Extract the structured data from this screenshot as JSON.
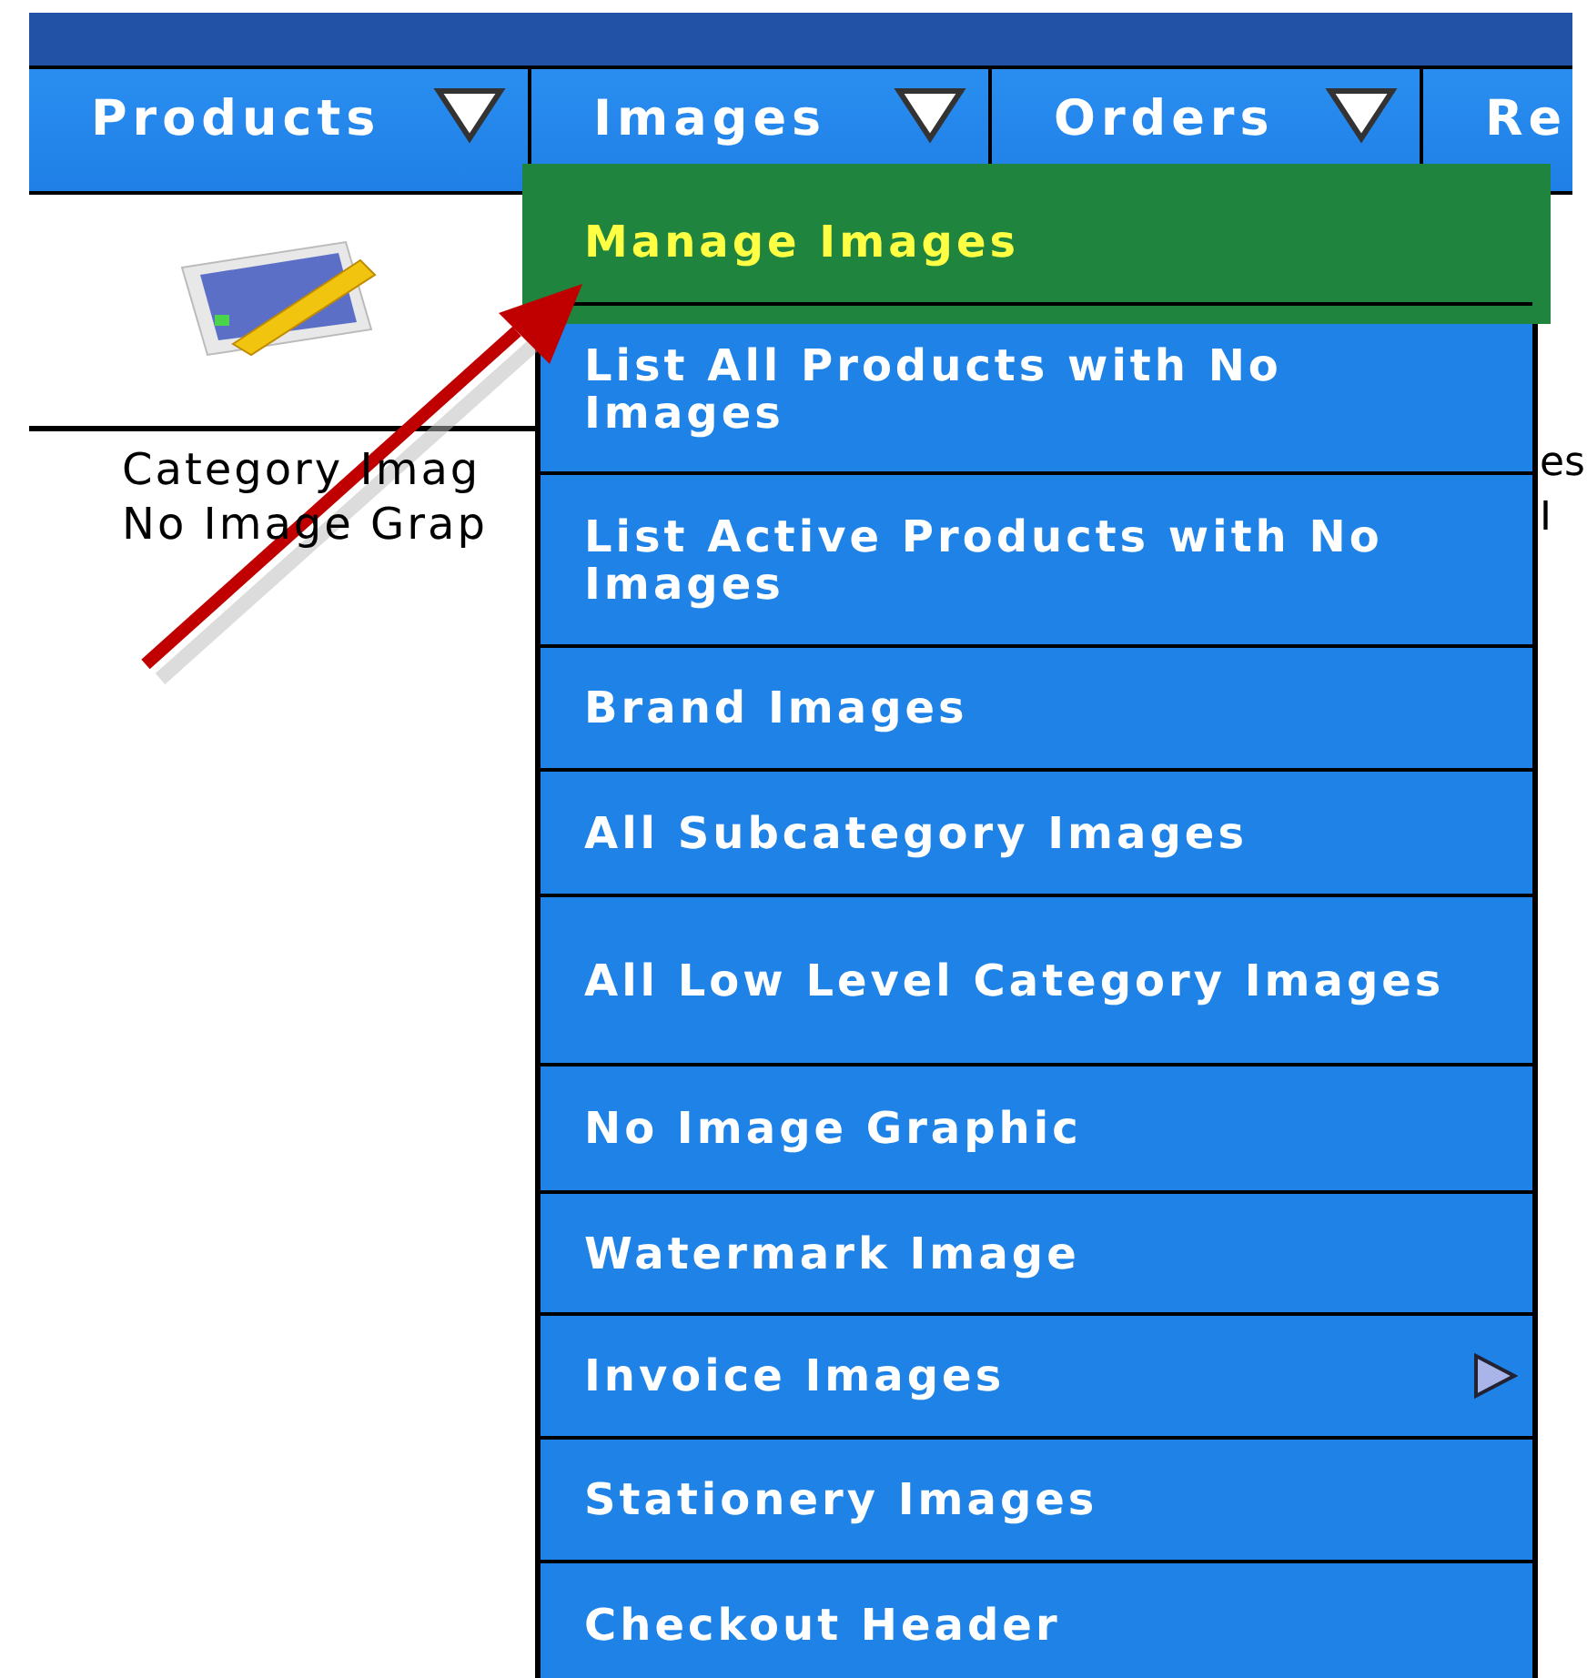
{
  "nav": {
    "tabs": [
      {
        "label": "Products"
      },
      {
        "label": "Images"
      },
      {
        "label": "Orders"
      },
      {
        "label": "Re"
      }
    ]
  },
  "content": {
    "lines": [
      "Category Imag",
      "No Image Grap"
    ],
    "right_fragments": [
      "es",
      "I"
    ]
  },
  "menu": {
    "items": [
      {
        "label": "Manage Images",
        "selected": true,
        "has_submenu": false
      },
      {
        "label": "List All Products with No Images",
        "selected": false,
        "has_submenu": false
      },
      {
        "label": "List Active Products with No Images",
        "selected": false,
        "has_submenu": false
      },
      {
        "label": "Brand Images",
        "selected": false,
        "has_submenu": false
      },
      {
        "label": "All Subcategory Images",
        "selected": false,
        "has_submenu": false
      },
      {
        "label": "All Low Level Category Images",
        "selected": false,
        "has_submenu": false
      },
      {
        "label": "No Image Graphic",
        "selected": false,
        "has_submenu": false
      },
      {
        "label": "Watermark Image",
        "selected": false,
        "has_submenu": false
      },
      {
        "label": "Invoice Images",
        "selected": false,
        "has_submenu": true
      },
      {
        "label": "Stationery Images",
        "selected": false,
        "has_submenu": false
      },
      {
        "label": "Checkout Header",
        "selected": false,
        "has_submenu": false
      }
    ]
  }
}
